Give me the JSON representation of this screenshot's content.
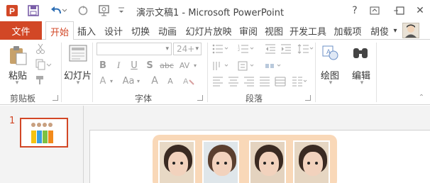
{
  "title": "演示文稿1 - Microsoft PowerPoint",
  "quick_access": {
    "save_icon": "save-icon",
    "undo_icon": "undo-icon",
    "redo_icon": "repeat-icon",
    "present_icon": "start-from-beginning-icon",
    "customize_icon": "customize-icon"
  },
  "window": {
    "help": "?",
    "display_options": "ribbon-display-icon",
    "minimize": "–",
    "restore": "☐",
    "close": "✕"
  },
  "tabs": {
    "file": "文件",
    "items": [
      "开始",
      "插入",
      "设计",
      "切换",
      "动画",
      "幻灯片放映",
      "审阅",
      "视图",
      "开发工具",
      "加载项"
    ],
    "active_index": 0,
    "user": "胡俊",
    "user_dropdown": "▾"
  },
  "ribbon": {
    "clipboard": {
      "paste": "粘贴",
      "group_label": "剪贴板"
    },
    "slides": {
      "new_slide": "幻灯片",
      "group_label": ""
    },
    "font": {
      "font_name": "",
      "font_size": "24+",
      "group_label": "字体",
      "bold": "B",
      "italic": "I",
      "underline": "U",
      "shadow": "S",
      "strike": "abc",
      "spacing": "AV",
      "case": "Aa",
      "grow": "A",
      "shrink": "A",
      "clear": "A"
    },
    "paragraph": {
      "group_label": "段落"
    },
    "drawing": {
      "label": "绘图"
    },
    "editing": {
      "label": "编辑"
    }
  },
  "slides_pane": {
    "slide_number": "1"
  },
  "colors": {
    "accent": "#d24726",
    "card": "#f9d8b8"
  }
}
